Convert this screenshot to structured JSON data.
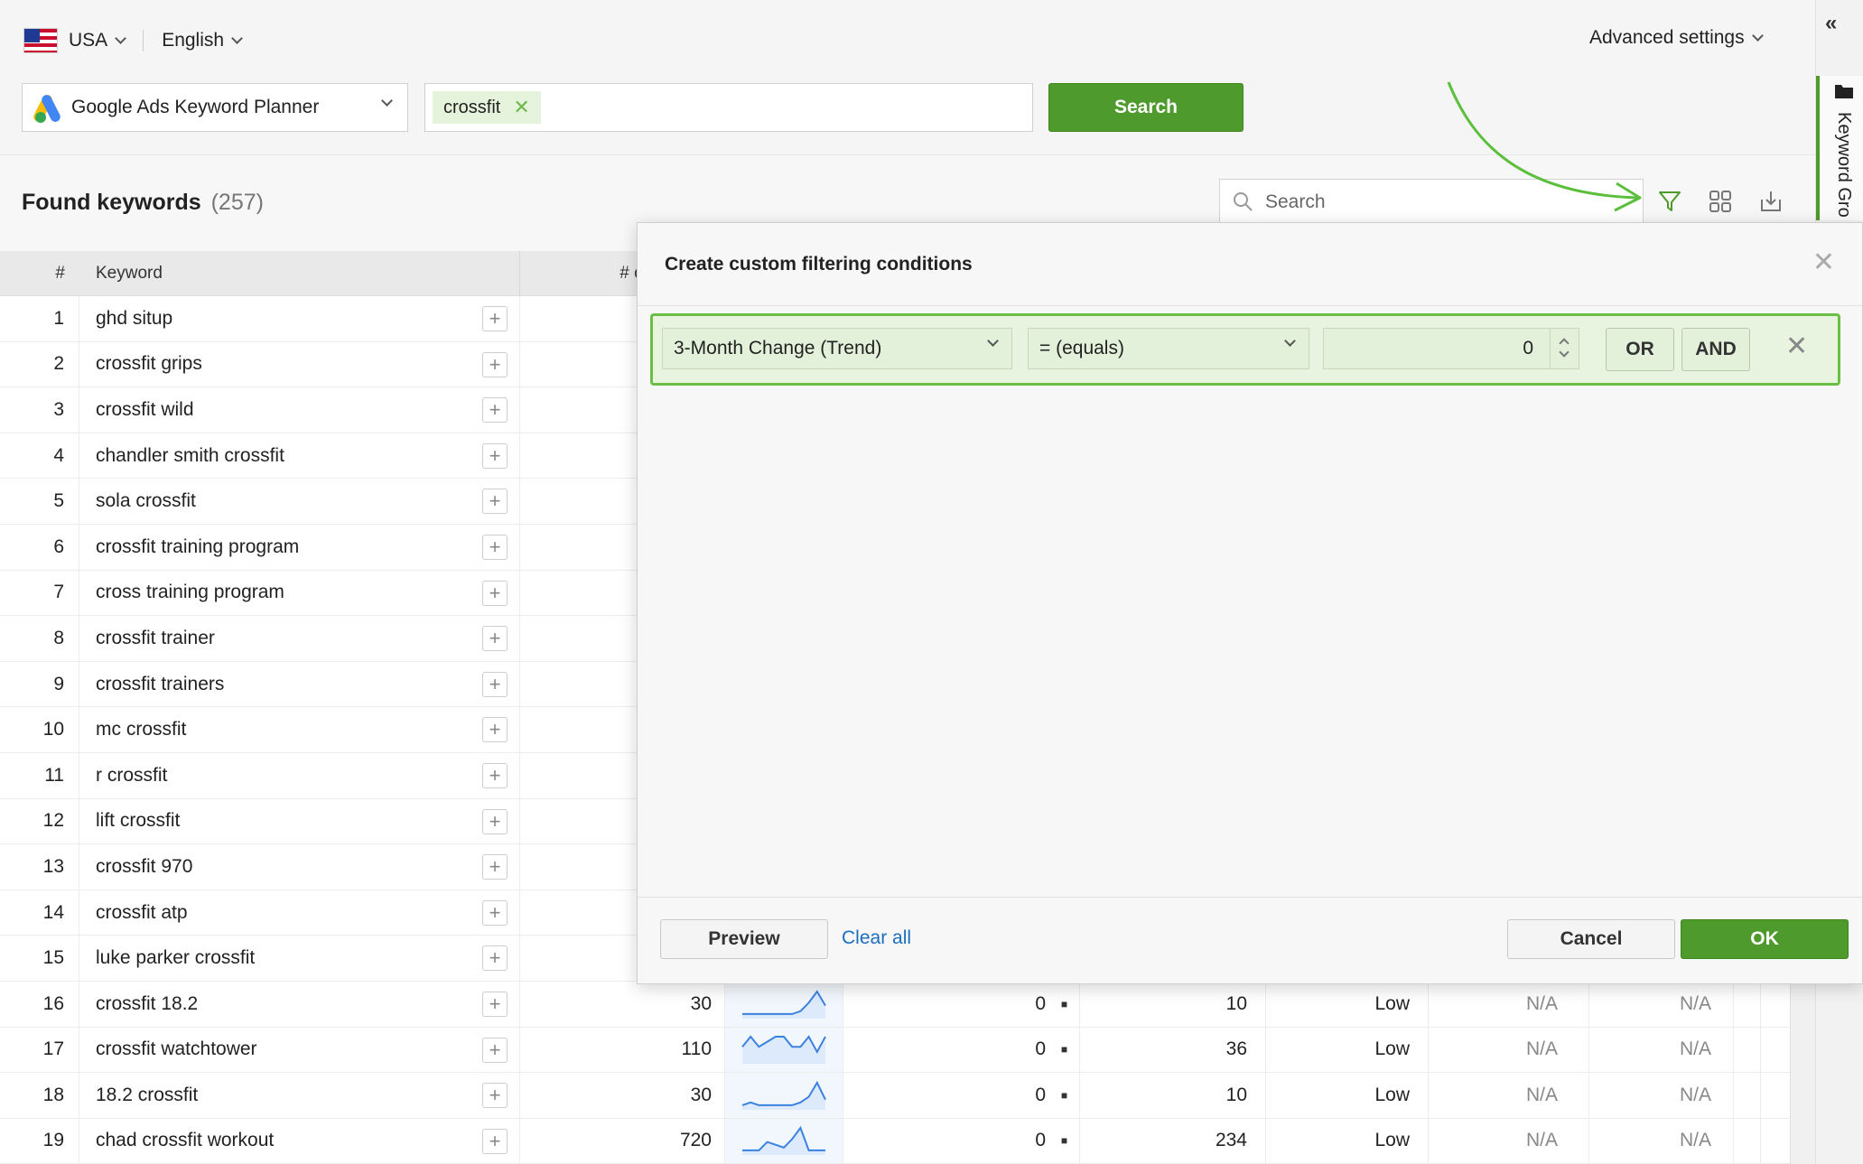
{
  "locale": {
    "country": "USA",
    "language": "English"
  },
  "header": {
    "advanced_settings": "Advanced settings"
  },
  "source": {
    "selected": "Google Ads Keyword Planner"
  },
  "keyword_input": {
    "tags": [
      "crossfit"
    ]
  },
  "search_button": "Search",
  "results": {
    "title": "Found keywords",
    "count": "(257)",
    "search_placeholder": "Search"
  },
  "side_panel": {
    "tab_label": "Keyword Gro"
  },
  "table": {
    "headers": {
      "num": "#",
      "keyword": "Keyword",
      "volume": "# of"
    },
    "rows": [
      {
        "n": "1",
        "kw": "ghd situp"
      },
      {
        "n": "2",
        "kw": "crossfit grips"
      },
      {
        "n": "3",
        "kw": "crossfit wild"
      },
      {
        "n": "4",
        "kw": "chandler smith crossfit"
      },
      {
        "n": "5",
        "kw": "sola crossfit"
      },
      {
        "n": "6",
        "kw": "crossfit training program"
      },
      {
        "n": "7",
        "kw": "cross training program"
      },
      {
        "n": "8",
        "kw": "crossfit trainer"
      },
      {
        "n": "9",
        "kw": "crossfit trainers"
      },
      {
        "n": "10",
        "kw": "mc crossfit"
      },
      {
        "n": "11",
        "kw": "r crossfit"
      },
      {
        "n": "12",
        "kw": "lift crossfit"
      },
      {
        "n": "13",
        "kw": "crossfit 970"
      },
      {
        "n": "14",
        "kw": "crossfit atp"
      },
      {
        "n": "15",
        "kw": "luke parker crossfit"
      },
      {
        "n": "16",
        "kw": "crossfit 18.2",
        "vol": "30",
        "change": "0",
        "comp": "10",
        "level": "Low",
        "na1": "N/A",
        "na2": "N/A",
        "trend": [
          1,
          1,
          1,
          1,
          1,
          1,
          1,
          2,
          5,
          9,
          4
        ]
      },
      {
        "n": "17",
        "kw": "crossfit watchtower",
        "vol": "110",
        "change": "0",
        "comp": "36",
        "level": "Low",
        "na1": "N/A",
        "na2": "N/A",
        "trend": [
          3,
          5,
          3,
          4,
          5,
          5,
          3,
          3,
          5,
          2,
          5
        ]
      },
      {
        "n": "18",
        "kw": "18.2 crossfit",
        "vol": "30",
        "change": "0",
        "comp": "10",
        "level": "Low",
        "na1": "N/A",
        "na2": "N/A",
        "trend": [
          1,
          2,
          1,
          1,
          1,
          1,
          1,
          2,
          4,
          9,
          3
        ]
      },
      {
        "n": "19",
        "kw": "chad crossfit workout",
        "vol": "720",
        "change": "0",
        "comp": "234",
        "level": "Low",
        "na1": "N/A",
        "na2": "N/A",
        "trend": [
          1,
          1,
          1,
          4,
          3,
          2,
          5,
          9,
          1,
          1,
          1
        ]
      }
    ]
  },
  "dialog": {
    "title": "Create custom filtering conditions",
    "condition": {
      "field": "3-Month Change (Trend)",
      "operator": "= (equals)",
      "value": "0",
      "or_label": "OR",
      "and_label": "AND"
    },
    "preview_label": "Preview",
    "clear_label": "Clear all",
    "cancel_label": "Cancel",
    "ok_label": "OK"
  },
  "colors": {
    "accent_green": "#4f9a2c",
    "highlight_green": "#6bbf45",
    "link_blue": "#1a6ec0",
    "trend_blue": "#3b82e0"
  }
}
